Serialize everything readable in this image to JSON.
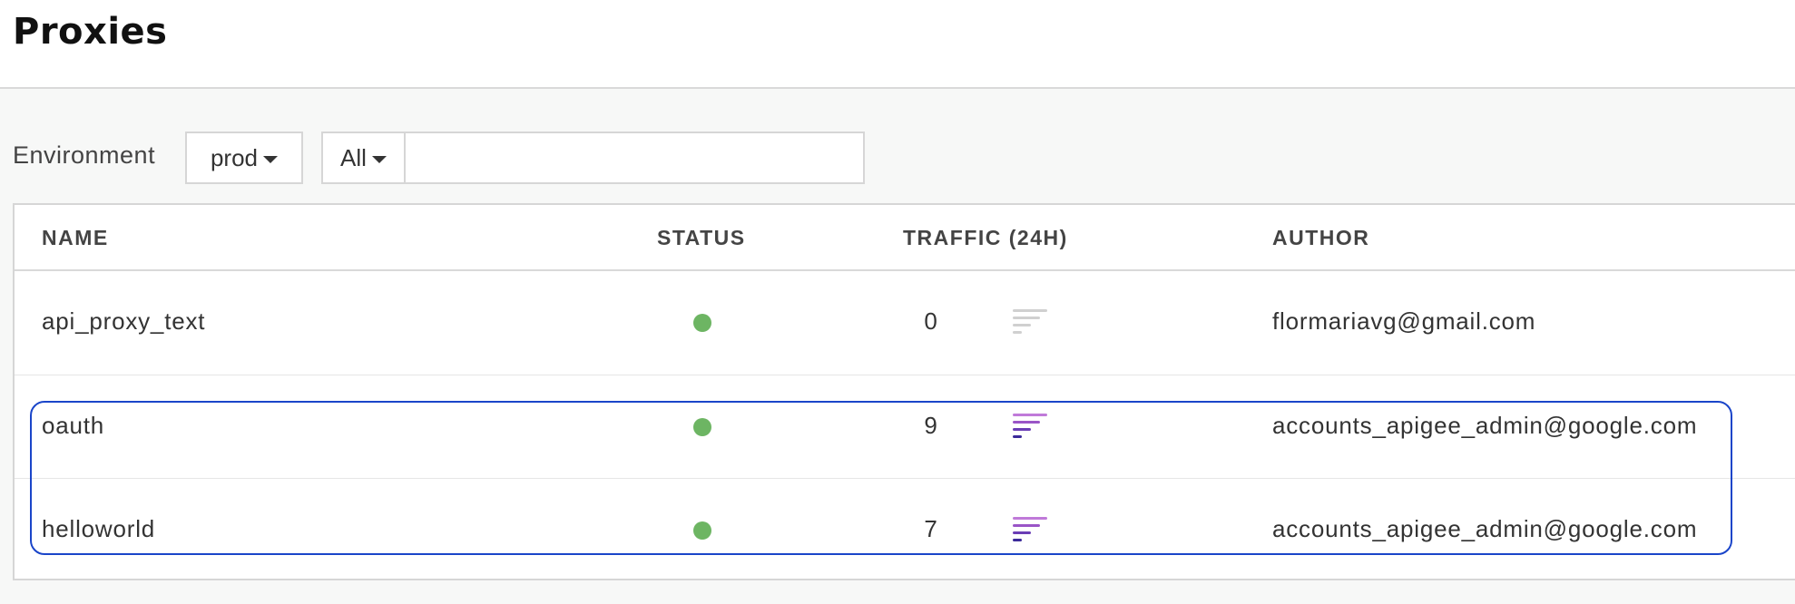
{
  "page": {
    "title": "Proxies"
  },
  "filters": {
    "environment_label": "Environment",
    "environment_value": "prod",
    "scope_value": "All",
    "search_value": ""
  },
  "table": {
    "columns": [
      "NAME",
      "STATUS",
      "TRAFFIC (24H)",
      "AUTHOR"
    ],
    "rows": [
      {
        "name": "api_proxy_text",
        "status": "deployed",
        "traffic": "0",
        "traffic_trend_color": "#d0d0d0",
        "author": "flormariavg@gmail.com"
      },
      {
        "name": "oauth",
        "status": "deployed",
        "traffic": "9",
        "traffic_trend_color": "#a855c9",
        "author": "accounts_apigee_admin@google.com"
      },
      {
        "name": "helloworld",
        "status": "deployed",
        "traffic": "7",
        "traffic_trend_color": "#a855c9",
        "author": "accounts_apigee_admin@google.com"
      }
    ]
  },
  "colors": {
    "status_ok": "#6db563",
    "selection_outline": "#1a45c9",
    "traffic_active_top": "#b46bd6",
    "traffic_active_bottom": "#3b2a9a",
    "traffic_idle": "#d0d0d0"
  }
}
